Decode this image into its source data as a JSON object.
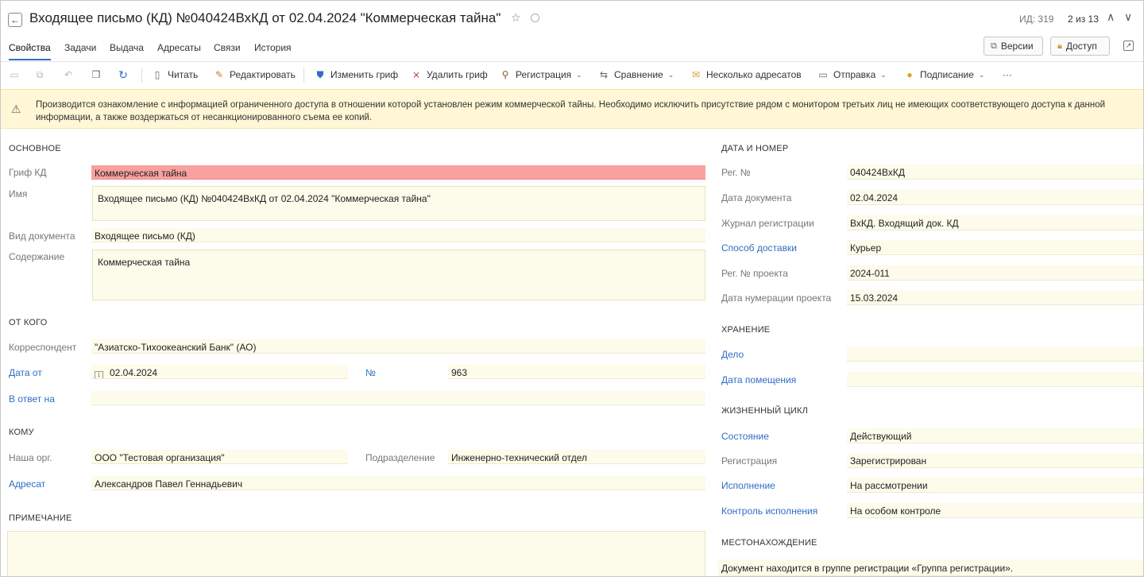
{
  "header": {
    "back_glyph": "←",
    "title": "Входящее письмо (КД) №040424ВхКД от 02.04.2024 \"Коммерческая тайна\"",
    "id_label": "ИД: 319",
    "pager": "2 из 13",
    "star_icon": "star-icon",
    "up_glyph": "∧",
    "down_glyph": "∨"
  },
  "tabs": [
    {
      "label": "Свойства",
      "active": true
    },
    {
      "label": "Задачи"
    },
    {
      "label": "Выдача"
    },
    {
      "label": "Адресаты"
    },
    {
      "label": "Связи"
    },
    {
      "label": "История"
    }
  ],
  "actions": {
    "versions": "Версии",
    "access": "Доступ"
  },
  "toolbar": {
    "read": "Читать",
    "edit": "Редактировать",
    "change_grif": "Изменить гриф",
    "delete_grif": "Удалить гриф",
    "registration": "Регистрация",
    "compare": "Сравнение",
    "multi_addressees": "Несколько адресатов",
    "send": "Отправка",
    "sign": "Подписание",
    "more": "···"
  },
  "banner": {
    "text": "Производится ознакомление с информацией ограниченного доступа в отношении которой установлен режим коммерческой тайны. Необходимо исключить присутствие рядом с монитором третьих лиц не имеющих соответствующего доступа к данной информации, а также воздержаться от несанкционированного съема ее копий."
  },
  "main": {
    "section_title": "ОСНОВНОЕ",
    "grif_label": "Гриф КД",
    "grif_value": "Коммерческая тайна",
    "name_label": "Имя",
    "name_value": "Входящее письмо (КД) №040424ВхКД от 02.04.2024 \"Коммерческая тайна\"",
    "doctype_label": "Вид документа",
    "doctype_value": "Входящее письмо (КД)",
    "content_label": "Содержание",
    "content_value": "Коммерческая тайна"
  },
  "from": {
    "section_title": "ОТ КОГО",
    "correspondent_label": "Корреспондент",
    "correspondent_value": "\"Азиатско-Тихоокеанский Банк\" (АО)",
    "date_label": "Дата от",
    "date_value": "02.04.2024",
    "number_label": "№",
    "number_value": "963",
    "reply_label": "В ответ на",
    "reply_value": ""
  },
  "to": {
    "section_title": "КОМУ",
    "org_label": "Наша орг.",
    "org_value": "ООО \"Тестовая организация\"",
    "dept_label": "Подразделение",
    "dept_value": "Инженерно-технический отдел",
    "addressee_label": "Адресат",
    "addressee_value": "Александров Павел Геннадьевич"
  },
  "note": {
    "section_title": "ПРИМЕЧАНИЕ",
    "value": ""
  },
  "datenum": {
    "section_title": "ДАТА И НОМЕР",
    "reg_no_label": "Рег. №",
    "reg_no_value": "040424ВхКД",
    "doc_date_label": "Дата документа",
    "doc_date_value": "02.04.2024",
    "journal_label": "Журнал регистрации",
    "journal_value": "ВхКД. Входящий док. КД",
    "delivery_label": "Способ доставки",
    "delivery_value": "Курьер",
    "proj_no_label": "Рег. № проекта",
    "proj_no_value": "2024-011",
    "proj_date_label": "Дата нумерации проекта",
    "proj_date_value": "15.03.2024"
  },
  "storage": {
    "section_title": "ХРАНЕНИЕ",
    "case_label": "Дело",
    "case_value": "",
    "place_date_label": "Дата помещения",
    "place_date_value": ""
  },
  "lifecycle": {
    "section_title": "ЖИЗНЕННЫЙ ЦИКЛ",
    "state_label": "Состояние",
    "state_value": "Действующий",
    "registration_label": "Регистрация",
    "registration_value": "Зарегистрирован",
    "execution_label": "Исполнение",
    "execution_value": "На рассмотрении",
    "control_label": "Контроль исполнения",
    "control_value": "На особом контроле"
  },
  "location": {
    "section_title": "МЕСТОНАХОЖДЕНИЕ",
    "text": "Документ находится в группе регистрации «Группа регистрации»."
  },
  "colors": {
    "accent": "#2e6ec4",
    "banner_bg": "#fff7d6",
    "field_bg": "#fdfbe9",
    "grif_red": "#f9a0a0"
  }
}
